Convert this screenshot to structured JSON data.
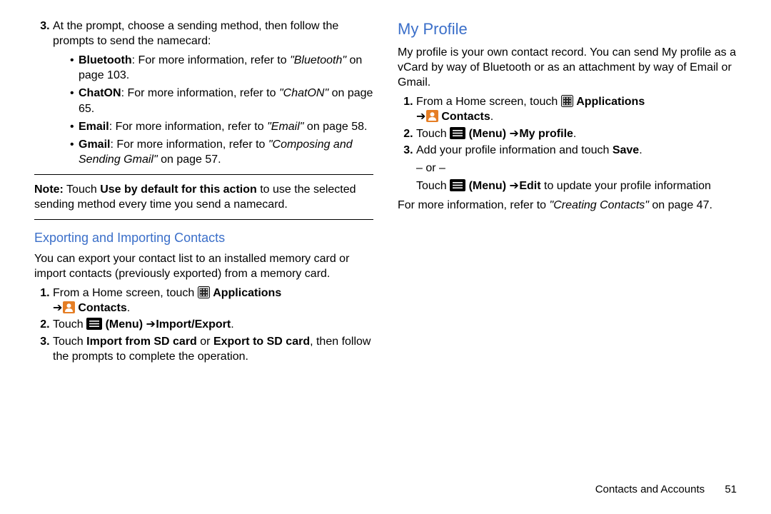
{
  "left": {
    "step3": {
      "intro": "At the prompt, choose a sending method, then follow the prompts to send the namecard:",
      "bullets": [
        {
          "bold": "Bluetooth",
          "text": ": For more information, refer to ",
          "italic": "\"Bluetooth\"",
          "after": " on page 103."
        },
        {
          "bold": "ChatON",
          "text": ": For more information, refer to ",
          "italic": "\"ChatON\"",
          "after": " on page 65."
        },
        {
          "bold": "Email",
          "text": ": For more information, refer to ",
          "italic": "\"Email\"",
          "after": " on page 58."
        },
        {
          "bold": "Gmail",
          "text": ": For more information, refer to ",
          "italic": "\"Composing and Sending Gmail\"",
          "after": " on page 57."
        }
      ]
    },
    "note": {
      "label": "Note:",
      "before": " Touch ",
      "bold": "Use by default for this action",
      "after": " to use the selected sending method every time you send a namecard."
    },
    "export_heading": "Exporting and Importing Contacts",
    "export_intro": "You can export your contact list to an installed memory card or import contacts (previously exported) from a memory card.",
    "export_steps": {
      "s1a": "From a Home screen, touch ",
      "s1b": " Applications",
      "s1_arrow": "  ",
      "s1c": " Contacts",
      "s1d": ".",
      "s2a": "Touch ",
      "s2_menu": " (Menu)",
      "s2_arrow": "  ",
      "s2b": " Import/Export",
      "s2c": ".",
      "s3a": "Touch ",
      "s3b1": "Import from SD card",
      "s3mid": " or ",
      "s3b2": "Export to SD card",
      "s3c": ", then follow the prompts to complete the operation."
    }
  },
  "right": {
    "heading": "My Profile",
    "intro": "My profile is your own contact record. You can send My profile as a vCard by way of Bluetooth or as an attachment by way of Email or Gmail.",
    "steps": {
      "s1a": "From a Home screen, touch ",
      "s1b": " Applications",
      "s1_arrow": "  ",
      "s1c": " Contacts",
      "s1d": ".",
      "s2a": "Touch ",
      "s2_menu": " (Menu)",
      "s2_arrow": "  ",
      "s2b": " My profile",
      "s2c": ".",
      "s3a": "Add your profile information and touch ",
      "s3b": "Save",
      "s3c": ".",
      "or": "– or –",
      "s3d": "Touch ",
      "s3_menu": " (Menu)",
      "s3_arrow": "  ",
      "s3e": " Edit",
      "s3f": " to update your profile information"
    },
    "more_a": "For more information, refer to ",
    "more_i": "\"Creating Contacts\"",
    "more_b": " on page 47."
  },
  "footer": {
    "section": "Contacts and Accounts",
    "page": "51"
  }
}
